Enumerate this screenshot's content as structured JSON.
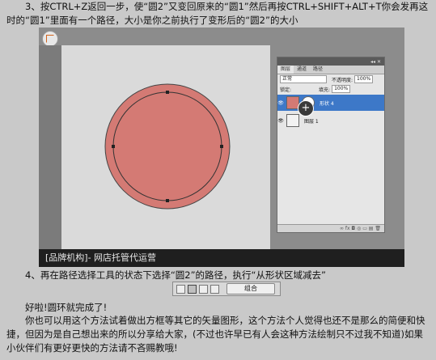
{
  "article": {
    "p1": "　　3、按CTRL+Z返回一步，使“圆2”又变回原来的“圆1”然后再按CTRL+SHIFT+ALT+T你会发再这时的“圆1”里面有一个路径，大小是你之前执行了变形后的“圆2”的大小",
    "p4": "　　4、再在路径选择工具的状态下选择“圆2”的路径，执行“从形状区域减去”",
    "p5": "　　好啦!圆环就完成了!",
    "p6": "　　你也可以用这个方法试着做出方框等其它的矢量图形，这个方法个人觉得也还不是那么的简便和快捷，但因为是自己想出来的所以分享给大家，(不过也许早已有人会这种方法绘制只不过我不知道)如果小伙伴们有更好更快的方法请不吝赐教哦!"
  },
  "screenshot": {
    "caption": "[品牌机构]- 网店托管代运营",
    "circle_fill": "#d47a74",
    "layers_panel": {
      "window_controls": "◂◂ ✕",
      "tabs": [
        "图层",
        "通道",
        "路径"
      ],
      "blend_mode": "正常",
      "opacity_label": "不透明度:",
      "opacity_value": "100%",
      "lock_label": "锁定:",
      "fill_label": "填充:",
      "fill_value": "100%",
      "layers": [
        {
          "name": "形状 4",
          "selected": true
        },
        {
          "name": "图层 1",
          "selected": false
        }
      ],
      "bottom_icons": "∞ fx ◘ ◎ ▭ ▤ 🗑"
    }
  },
  "optionbar": {
    "combine_label": "组合"
  }
}
